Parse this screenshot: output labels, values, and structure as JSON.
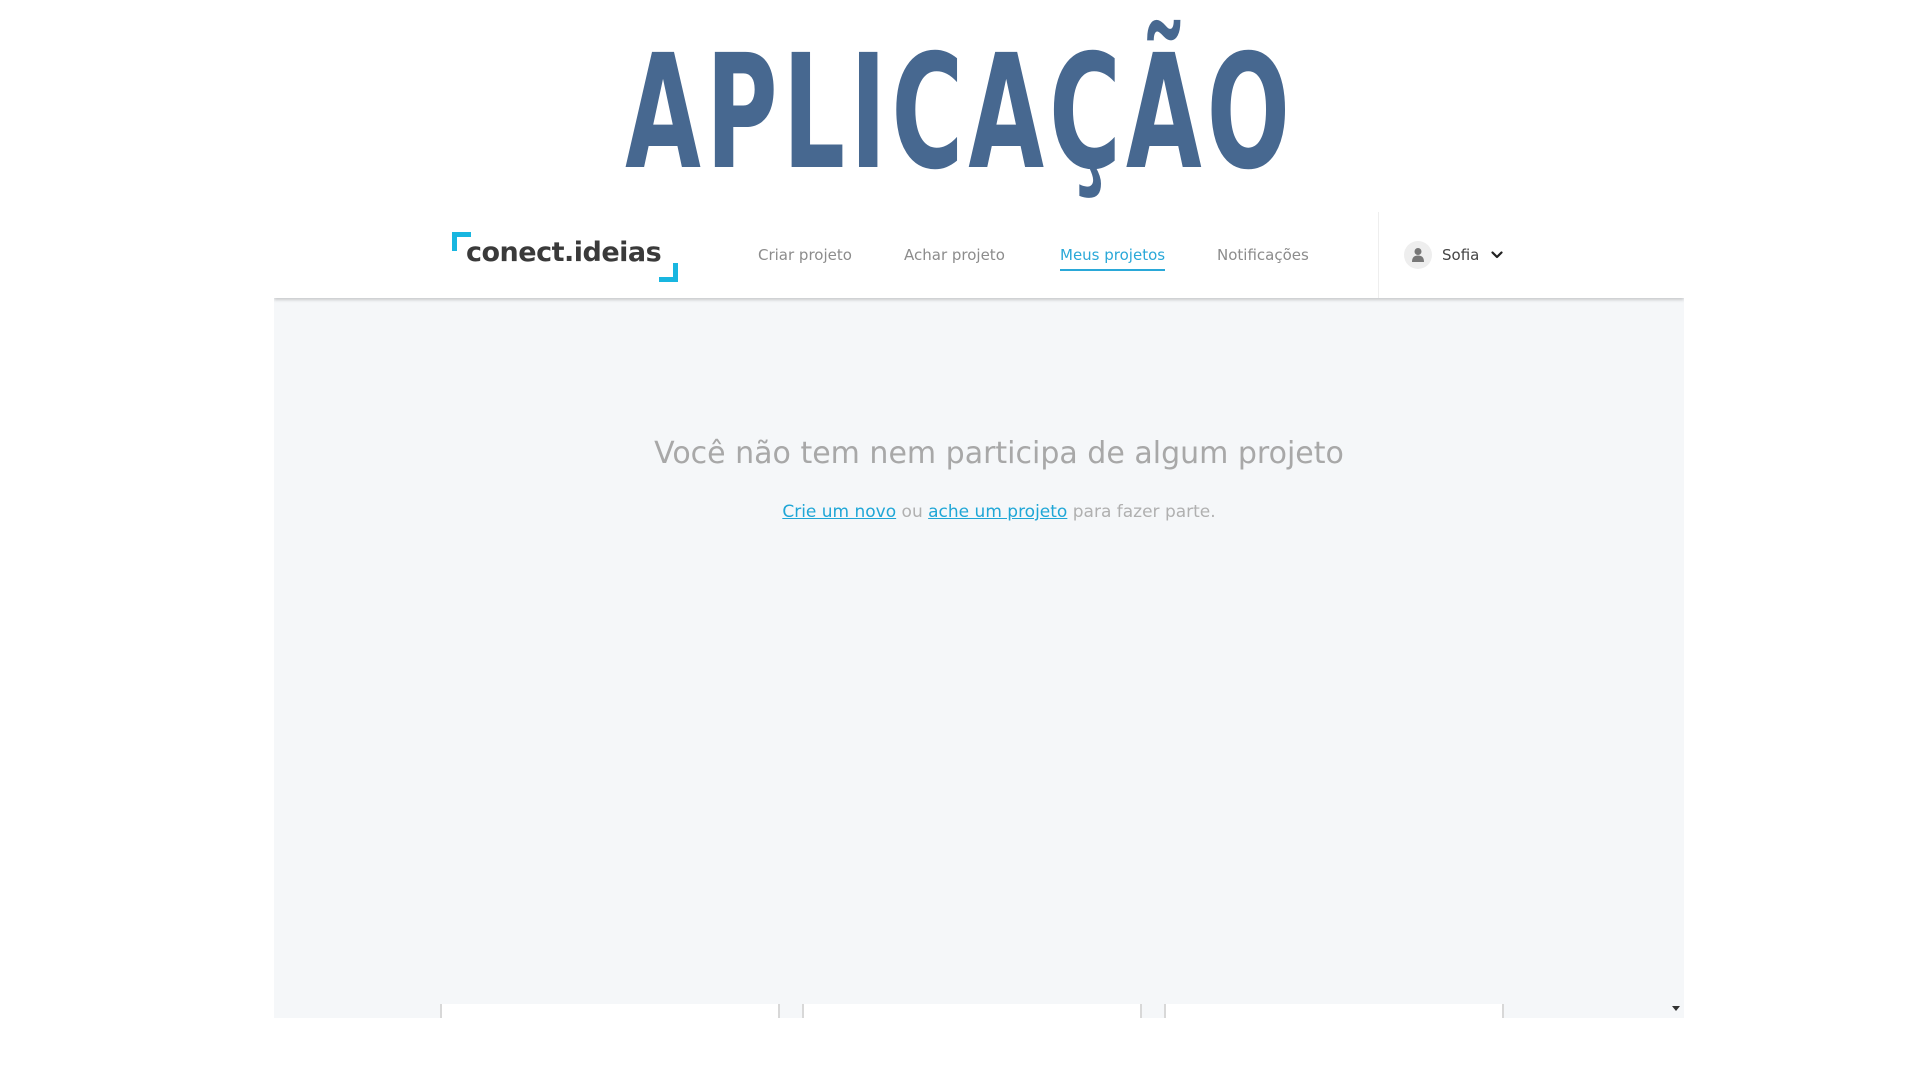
{
  "slide": {
    "title": "APLICAÇÃO"
  },
  "logo": {
    "text": "conect.ideias"
  },
  "nav": {
    "items": [
      {
        "label": "Criar projeto",
        "active": false
      },
      {
        "label": "Achar projeto",
        "active": false
      },
      {
        "label": "Meus projetos",
        "active": true
      },
      {
        "label": "Notificações",
        "active": false
      }
    ]
  },
  "user": {
    "name": "Sofia",
    "avatar_icon": "user-icon",
    "menu_icon": "chevron-down-icon"
  },
  "empty_state": {
    "title": "Você não tem nem participa de algum projeto",
    "link_new": "Crie um novo",
    "or": " ou ",
    "link_find": "ache um projeto",
    "suffix": " para fazer parte."
  },
  "colors": {
    "title": "#476890",
    "accent": "#18b6e0",
    "link": "#1fa6d6",
    "background": "#f5f7f9"
  }
}
